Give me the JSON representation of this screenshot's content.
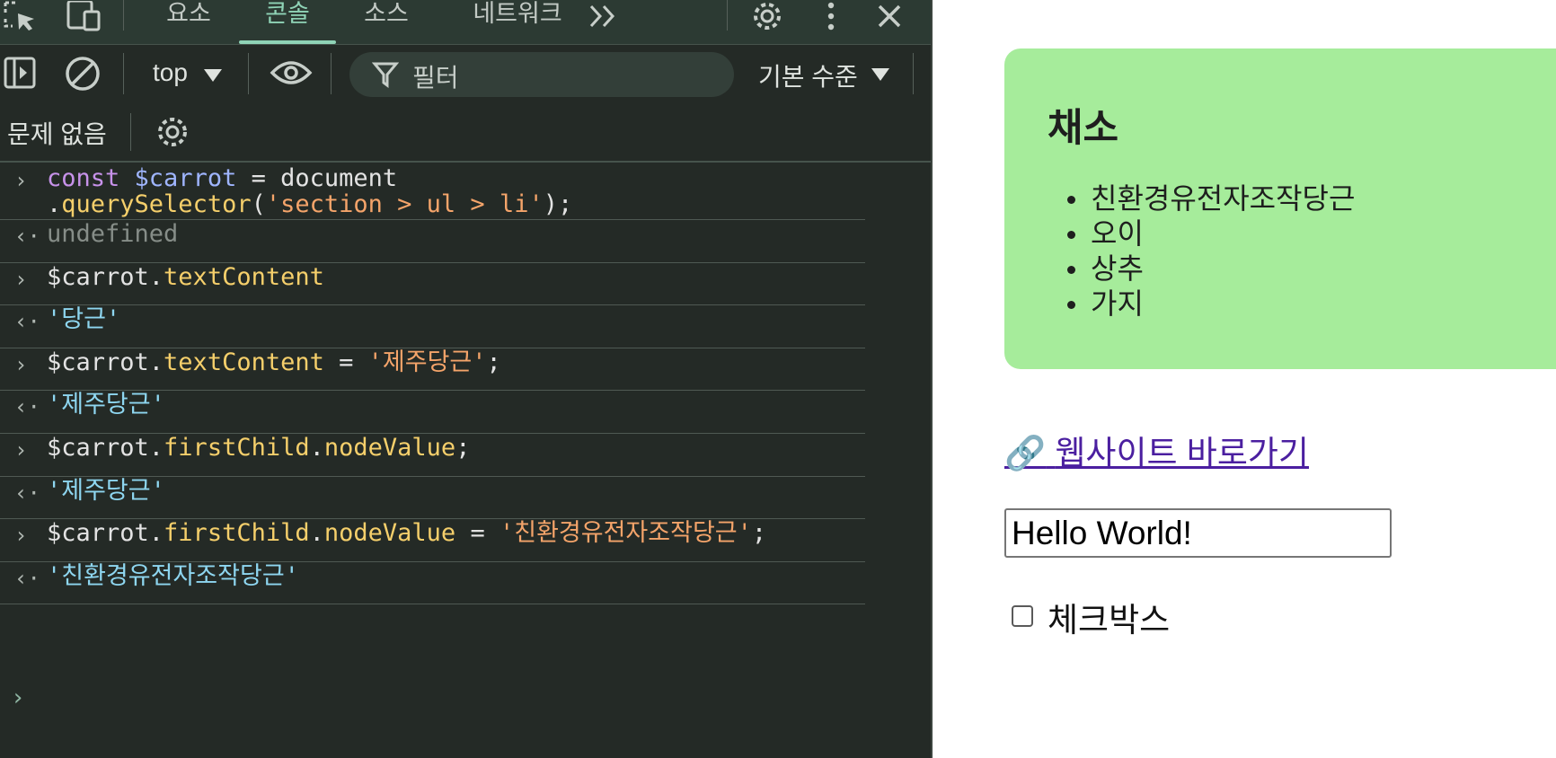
{
  "devtools": {
    "tabs": [
      {
        "label": "요소",
        "active": false
      },
      {
        "label": "콘솔",
        "active": true
      },
      {
        "label": "소스",
        "active": false
      },
      {
        "label": "네트워크",
        "active": false
      }
    ],
    "icons": {
      "inspect": "inspect-element-icon",
      "device": "device-toolbar-icon",
      "more_tabs": "more-tabs-icon",
      "settings": "gear-icon",
      "menu": "kebab-menu-icon",
      "close": "close-icon"
    },
    "toolbar": {
      "context": "top",
      "filter_placeholder": "필터",
      "level": "기본 수준"
    },
    "issues_label": "문제 없음",
    "console_lines": [
      {
        "type": "input",
        "tokens": [
          [
            "kw",
            "const "
          ],
          [
            "var",
            "$carrot"
          ],
          [
            "plain",
            " = document"
          ]
        ],
        "line2": [
          [
            "plain",
            "."
          ],
          [
            "prop",
            "querySelector"
          ],
          [
            "plain",
            "("
          ],
          [
            "str",
            "'section > ul > li'"
          ],
          [
            "plain",
            ");"
          ]
        ]
      },
      {
        "type": "output",
        "tokens": [
          [
            "undef",
            "undefined"
          ]
        ]
      },
      {
        "type": "input",
        "tokens": [
          [
            "plain",
            "$carrot."
          ],
          [
            "prop",
            "textContent"
          ]
        ]
      },
      {
        "type": "output",
        "tokens": [
          [
            "res-str",
            "'당근'"
          ]
        ]
      },
      {
        "type": "input",
        "tokens": [
          [
            "plain",
            "$carrot."
          ],
          [
            "prop",
            "textContent"
          ],
          [
            "plain",
            " = "
          ],
          [
            "str",
            "'제주당근'"
          ],
          [
            "plain",
            ";"
          ]
        ]
      },
      {
        "type": "output",
        "tokens": [
          [
            "res-str",
            "'제주당근'"
          ]
        ]
      },
      {
        "type": "input",
        "tokens": [
          [
            "plain",
            "$carrot."
          ],
          [
            "prop",
            "firstChild"
          ],
          [
            "plain",
            "."
          ],
          [
            "prop",
            "nodeValue"
          ],
          [
            "plain",
            ";"
          ]
        ]
      },
      {
        "type": "output",
        "tokens": [
          [
            "res-str",
            "'제주당근'"
          ]
        ]
      },
      {
        "type": "input",
        "tokens": [
          [
            "plain",
            "$carrot."
          ],
          [
            "prop",
            "firstChild"
          ],
          [
            "plain",
            "."
          ],
          [
            "prop",
            "nodeValue"
          ],
          [
            "plain",
            " = "
          ],
          [
            "str",
            "'친환경유전자조작당근'"
          ],
          [
            "plain",
            ";"
          ]
        ]
      },
      {
        "type": "output",
        "tokens": [
          [
            "res-str",
            "'친환경유전자조작당근'"
          ]
        ]
      }
    ],
    "colors": {
      "background": "#242a26",
      "tab_active": "#8fd3b6",
      "keyword": "#c792ea",
      "variable": "#9fb5ff",
      "property": "#f5cf6b",
      "string": "#f4a46a",
      "result_string": "#8ed6f0"
    }
  },
  "page": {
    "section_title": "채소",
    "vegetables": [
      "친환경유전자조작당근",
      "오이",
      "상추",
      "가지"
    ],
    "link_icon": "link-icon",
    "link_emoji": "🔗",
    "link_text": "웹사이트 바로가기",
    "input_value": "Hello World!",
    "checkbox_label": "체크박스",
    "checkbox_checked": false,
    "colors": {
      "card": "#a6ec9b",
      "link": "#4b1fa0"
    }
  }
}
